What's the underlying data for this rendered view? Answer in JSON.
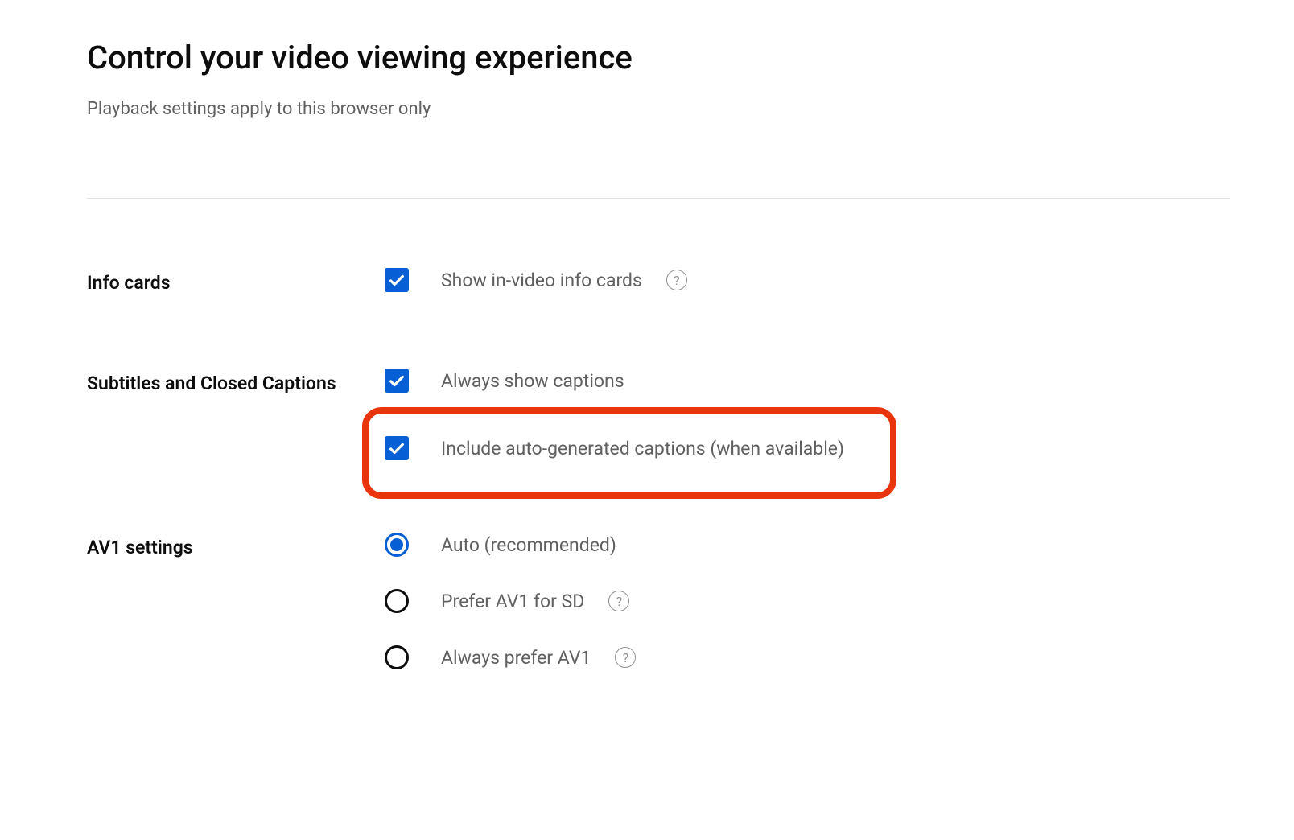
{
  "header": {
    "title": "Control your video viewing experience",
    "subtitle": "Playback settings apply to this browser only"
  },
  "sections": {
    "info_cards": {
      "label": "Info cards",
      "options": {
        "show_cards": {
          "label": "Show in-video info cards",
          "checked": true,
          "has_help": true
        }
      }
    },
    "subtitles": {
      "label": "Subtitles and Closed Captions",
      "options": {
        "always_show": {
          "label": "Always show captions",
          "checked": true,
          "has_help": false
        },
        "auto_generated": {
          "label": "Include auto-generated captions (when available)",
          "checked": true,
          "has_help": false,
          "highlighted": true
        }
      }
    },
    "av1": {
      "label": "AV1 settings",
      "options": {
        "auto": {
          "label": "Auto (recommended)",
          "selected": true,
          "has_help": false
        },
        "prefer_sd": {
          "label": "Prefer AV1 for SD",
          "selected": false,
          "has_help": true
        },
        "always": {
          "label": "Always prefer AV1",
          "selected": false,
          "has_help": true
        }
      }
    }
  },
  "help_glyph": "?"
}
